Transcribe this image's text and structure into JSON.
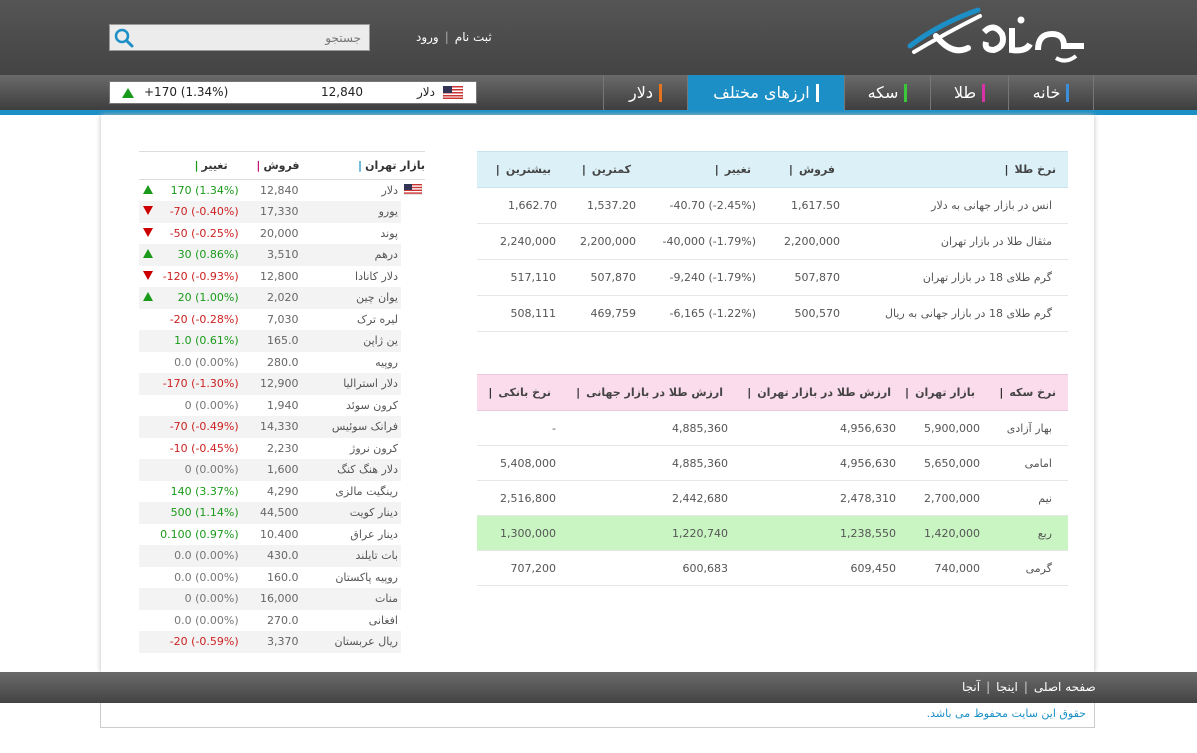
{
  "header": {
    "search_placeholder": "جستجو",
    "signup": "ثبت نام",
    "login": "ورود"
  },
  "nav": [
    {
      "label": "خانه",
      "color": "#3a8fd8"
    },
    {
      "label": "طلا",
      "color": "#d832a8"
    },
    {
      "label": "سکه",
      "color": "#3ac83a"
    },
    {
      "label": "ارزهای مختلف",
      "color": "#ffffff"
    },
    {
      "label": "دلار",
      "color": "#e8731c"
    }
  ],
  "ticker": {
    "name": "دلار",
    "value": "12,840",
    "change": "+170 (1.34%)",
    "direction": "up"
  },
  "gold_table": {
    "headers": [
      "نرخ طلا",
      "فروش",
      "تغییر",
      "کمترین",
      "بیشترین"
    ],
    "rows": [
      {
        "name": "انس در بازار جهانی به دلار",
        "sell": "1,617.50",
        "change": "-40.70 (-2.45%)",
        "min": "1,537.20",
        "max": "1,662.70"
      },
      {
        "name": "مثقال طلا در بازار تهران",
        "sell": "2,200,000",
        "change": "-40,000 (-1.79%)",
        "min": "2,200,000",
        "max": "2,240,000"
      },
      {
        "name": "گرم طلای 18 در بازار تهران",
        "sell": "507,870",
        "change": "-9,240 (-1.79%)",
        "min": "507,870",
        "max": "517,110"
      },
      {
        "name": "گرم طلای 18 در بازار جهانی به ریال",
        "sell": "500,570",
        "change": "-6,165 (-1.22%)",
        "min": "469,759",
        "max": "508,111"
      }
    ]
  },
  "coin_table": {
    "headers": [
      "نرخ سکه",
      "بازار تهران",
      "ارزش طلا در بازار تهران",
      "ارزش طلا در بازار جهانی",
      "نرخ بانکی"
    ],
    "rows": [
      {
        "name": "بهار آزادی",
        "tehran": "5,900,000",
        "gold_tehran": "4,956,630",
        "gold_world": "4,885,360",
        "bank": "-"
      },
      {
        "name": "امامی",
        "tehran": "5,650,000",
        "gold_tehran": "4,956,630",
        "gold_world": "4,885,360",
        "bank": "5,408,000"
      },
      {
        "name": "نیم",
        "tehran": "2,700,000",
        "gold_tehran": "2,478,310",
        "gold_world": "2,442,680",
        "bank": "2,516,800"
      },
      {
        "name": "ربع",
        "tehran": "1,420,000",
        "gold_tehran": "1,238,550",
        "gold_world": "1,220,740",
        "bank": "1,300,000"
      },
      {
        "name": "گرمی",
        "tehran": "740,000",
        "gold_tehran": "609,450",
        "gold_world": "600,683",
        "bank": "707,200"
      }
    ]
  },
  "currency_table": {
    "headers": [
      "بازار تهران",
      "فروش",
      "تغییر"
    ],
    "rows": [
      {
        "name": "دلار",
        "value": "12,840",
        "change": "170 (1.34%)",
        "trend": "up"
      },
      {
        "name": "یورو",
        "value": "17,330",
        "change": "-70 (-0.40%)",
        "trend": "down"
      },
      {
        "name": "پوند",
        "value": "20,000",
        "change": "-50 (-0.25%)",
        "trend": "down"
      },
      {
        "name": "درهم",
        "value": "3,510",
        "change": "30 (0.86%)",
        "trend": "up"
      },
      {
        "name": "دلار کانادا",
        "value": "12,800",
        "change": "-120 (-0.93%)",
        "trend": "down"
      },
      {
        "name": "یوان چین",
        "value": "2,020",
        "change": "20 (1.00%)",
        "trend": "up"
      },
      {
        "name": "لیره ترک",
        "value": "7,030",
        "change": "-20 (-0.28%)",
        "trend": "none"
      },
      {
        "name": "ین ژاپن",
        "value": "165.0",
        "change": "1.0 (0.61%)",
        "trend": "none"
      },
      {
        "name": "روپیه",
        "value": "280.0",
        "change": "0.0 (0.00%)",
        "trend": "none"
      },
      {
        "name": "دلار استرالیا",
        "value": "12,900",
        "change": "-170 (-1.30%)",
        "trend": "none"
      },
      {
        "name": "کرون سوئد",
        "value": "1,940",
        "change": "0 (0.00%)",
        "trend": "none"
      },
      {
        "name": "فرانک سوئیس",
        "value": "14,330",
        "change": "-70 (-0.49%)",
        "trend": "none"
      },
      {
        "name": "کرون نروژ",
        "value": "2,230",
        "change": "-10 (-0.45%)",
        "trend": "none"
      },
      {
        "name": "دلار هنگ کنگ",
        "value": "1,600",
        "change": "0 (0.00%)",
        "trend": "none"
      },
      {
        "name": "رینگیت مالزی",
        "value": "4,290",
        "change": "140 (3.37%)",
        "trend": "none"
      },
      {
        "name": "دینار کویت",
        "value": "44,500",
        "change": "500 (1.14%)",
        "trend": "none"
      },
      {
        "name": "دینار عراق",
        "value": "10.400",
        "change": "0.100 (0.97%)",
        "trend": "none"
      },
      {
        "name": "بات تایلند",
        "value": "430.0",
        "change": "0.0 (0.00%)",
        "trend": "none"
      },
      {
        "name": "روپیه پاکستان",
        "value": "160.0",
        "change": "0.0 (0.00%)",
        "trend": "none"
      },
      {
        "name": "منات",
        "value": "16,000",
        "change": "0 (0.00%)",
        "trend": "none"
      },
      {
        "name": "افغانی",
        "value": "270.0",
        "change": "0.0 (0.00%)",
        "trend": "none"
      },
      {
        "name": "ریال عربستان",
        "value": "3,370",
        "change": "-20 (-0.59%)",
        "trend": "none"
      }
    ]
  },
  "footer": {
    "links": [
      "صفحه اصلی",
      "اینجا",
      "آنجا"
    ],
    "copyright": "حقوق این سایت محفوظ می باشد."
  }
}
